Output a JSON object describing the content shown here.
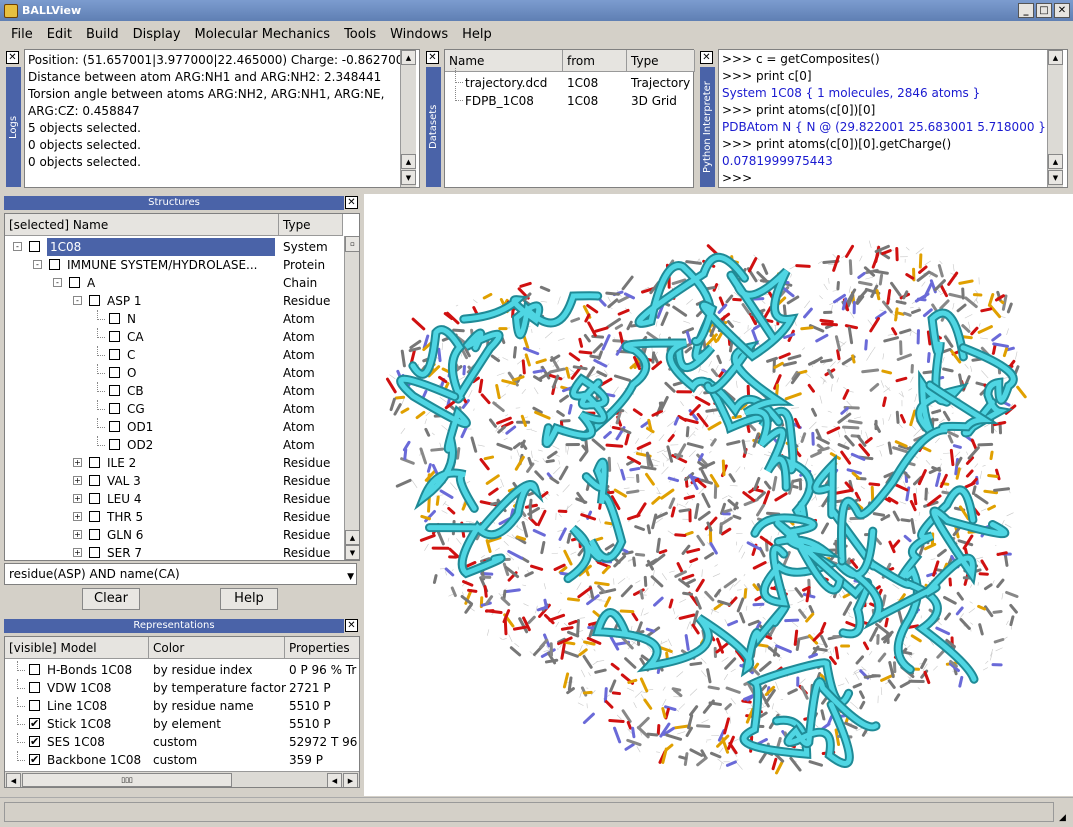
{
  "window": {
    "title": "BALLView"
  },
  "menu": [
    "File",
    "Edit",
    "Build",
    "Display",
    "Molecular Mechanics",
    "Tools",
    "Windows",
    "Help"
  ],
  "logs": {
    "tab": "Logs",
    "lines": [
      "Position: (51.657001|3.977000|22.465000)  Charge: -0.862700",
      "Distance between atom ARG:NH1 and ARG:NH2: 2.348441",
      "Torsion angle between atoms ARG:NH2, ARG:NH1, ARG:NE,",
      "ARG:CZ: 0.458847",
      "5 objects selected.",
      "0 objects selected.",
      "0 objects selected."
    ]
  },
  "datasets": {
    "tab": "Datasets",
    "headers": [
      "Name",
      "from",
      "Type"
    ],
    "rows": [
      {
        "name": "trajectory.dcd",
        "from": "1C08",
        "type": "Trajectory"
      },
      {
        "name": "FDPB_1C08",
        "from": "1C08",
        "type": "3D Grid"
      }
    ]
  },
  "python": {
    "tab": "Python Interpreter",
    "lines": [
      {
        "text": ">>> c = getComposites()",
        "blue": false
      },
      {
        "text": ">>> print c[0]",
        "blue": false
      },
      {
        "text": "System 1C08 { 1 molecules,  2846 atoms }",
        "blue": true
      },
      {
        "text": ">>> print atoms(c[0])[0]",
        "blue": false
      },
      {
        "text": "PDBAtom N { N @ (29.822001 25.683001 5.718000 }",
        "blue": true
      },
      {
        "text": ">>> print atoms(c[0])[0].getCharge()",
        "blue": false
      },
      {
        "text": "0.0781999975443",
        "blue": true
      },
      {
        "text": ">>>",
        "blue": false
      }
    ]
  },
  "structures": {
    "title": "Structures",
    "headers": [
      "[selected] Name",
      "Type"
    ],
    "rows": [
      {
        "indent": 0,
        "name": "1C08",
        "type": "System",
        "exp": "-",
        "sel": true
      },
      {
        "indent": 1,
        "name": "IMMUNE SYSTEM/HYDROLASE...",
        "type": "Protein",
        "exp": "-"
      },
      {
        "indent": 2,
        "name": "A",
        "type": "Chain",
        "exp": "-"
      },
      {
        "indent": 3,
        "name": "ASP 1",
        "type": "Residue",
        "exp": "-"
      },
      {
        "indent": 4,
        "name": "N",
        "type": "Atom"
      },
      {
        "indent": 4,
        "name": "CA",
        "type": "Atom"
      },
      {
        "indent": 4,
        "name": "C",
        "type": "Atom"
      },
      {
        "indent": 4,
        "name": "O",
        "type": "Atom"
      },
      {
        "indent": 4,
        "name": "CB",
        "type": "Atom"
      },
      {
        "indent": 4,
        "name": "CG",
        "type": "Atom"
      },
      {
        "indent": 4,
        "name": "OD1",
        "type": "Atom"
      },
      {
        "indent": 4,
        "name": "OD2",
        "type": "Atom"
      },
      {
        "indent": 3,
        "name": "ILE 2",
        "type": "Residue",
        "exp": "+"
      },
      {
        "indent": 3,
        "name": "VAL 3",
        "type": "Residue",
        "exp": "+"
      },
      {
        "indent": 3,
        "name": "LEU 4",
        "type": "Residue",
        "exp": "+"
      },
      {
        "indent": 3,
        "name": "THR 5",
        "type": "Residue",
        "exp": "+"
      },
      {
        "indent": 3,
        "name": "GLN 6",
        "type": "Residue",
        "exp": "+"
      },
      {
        "indent": 3,
        "name": "SER 7",
        "type": "Residue",
        "exp": "+"
      }
    ],
    "query": "residue(ASP) AND name(CA)",
    "clear_label": "Clear",
    "help_label": "Help"
  },
  "representations": {
    "title": "Representations",
    "headers": [
      "[visible] Model",
      "Color",
      "Properties"
    ],
    "rows": [
      {
        "model": "H-Bonds  1C08",
        "color": "by residue index",
        "props": "0 P 96 % Tr",
        "on": false
      },
      {
        "model": "VDW  1C08",
        "color": "by temperature factor",
        "props": "2721 P",
        "on": false
      },
      {
        "model": "Line  1C08",
        "color": "by residue name",
        "props": "5510 P",
        "on": false
      },
      {
        "model": "Stick  1C08",
        "color": "by element",
        "props": "5510 P",
        "on": true
      },
      {
        "model": "SES  1C08",
        "color": "custom",
        "props": "52972 T 96",
        "on": true
      },
      {
        "model": "Backbone  1C08",
        "color": "custom",
        "props": "359 P",
        "on": true
      }
    ]
  }
}
